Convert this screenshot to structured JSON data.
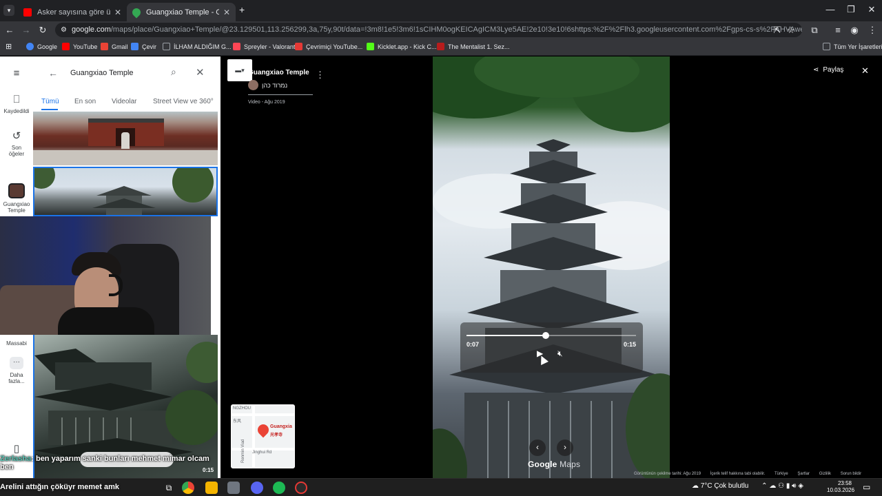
{
  "browser": {
    "tabs": [
      {
        "title": "Asker sayısına göre ülkeler - YouTube",
        "active": false,
        "favicon_color": "#ff0000"
      },
      {
        "title": "Guangxiao Temple - Google Haritalar",
        "active": true,
        "favicon_color": "#34a853"
      }
    ],
    "url_host": "google.com",
    "url_rest": "/maps/place/Guangxiao+Temple/@23.129501,113.256299,3a,75y,90t/data=!3m8!1e5!3m6!1sCIHM0ogKEICAgICM3Lye5AE!2e10!3e10!6shttps:%2F%2Flh3.googleusercontent.com%2Fgps-cs-s%2FAHVAwepova-b2nGUfNemF-DLiL2gT...",
    "bookmarks": [
      {
        "label": "Google",
        "color": "#4285f4"
      },
      {
        "label": "YouTube",
        "color": "#ff0000"
      },
      {
        "label": "Gmail",
        "color": "#ea4335"
      },
      {
        "label": "Çevir",
        "color": "#4285f4"
      },
      {
        "label": "İLHAM ALDIĞIM G...",
        "color": "#9aa0a6"
      },
      {
        "label": "Spreyler - Valorant",
        "color": "#ff4655"
      },
      {
        "label": "Çevrimiçi YouTube...",
        "color": "#e53935"
      },
      {
        "label": "Kicklet.app - Kick C...",
        "color": "#53fc18"
      },
      {
        "label": "The Mentalist 1. Sez...",
        "color": "#b71c1c"
      }
    ],
    "all_bookmarks": "Tüm Yer İşaretleri"
  },
  "maps": {
    "search_value": "Guangxiao Temple",
    "rail": [
      {
        "label": "Kaydedildi",
        "icon": "bookmark-icon"
      },
      {
        "label": "Son öğeler",
        "icon": "history-icon"
      },
      {
        "label": "Guangxiao Temple",
        "icon": "place-thumbnail"
      },
      {
        "label": "Massabi",
        "icon": "place-thumbnail"
      },
      {
        "label": "Daha fazla...",
        "icon": "more-icon"
      }
    ],
    "photo_tabs": [
      "Tümü",
      "En son",
      "Videolar",
      "Street View ve 360°"
    ]
  },
  "viewer": {
    "place_title": "Guangxiao Temple",
    "author": "נמרוד כהן",
    "meta": "Video - Ağu 2019",
    "current_time": "0:07",
    "duration": "0:15",
    "progress": 0.4667,
    "share_label": "Paylaş",
    "logo_google": "Google",
    "logo_maps": "Maps",
    "footer": [
      "Görüntünün çekilme tarihi: Ağu 2019",
      "İçerik telif hakkına tabi olabilir.",
      "Türkiye",
      "Şartlar",
      "Gizlilik",
      "Sorun bildir"
    ],
    "minimap_label": "Guangxia",
    "minimap_label_cn": "光孝寺",
    "minimap_roads": [
      "Renmin Viad",
      "Jinghui Rd",
      "NGZHOU",
      "东风"
    ]
  },
  "stream": {
    "chat_user": "Zerlasha",
    "chat_text": ": ben yaparım sanki bunları mehmet mimar olcam ben",
    "chat_time": "0:15",
    "ticker": "Arelini attığın çöküyr memet amk"
  },
  "taskbar": {
    "weather": "7°C  Çok bulutlu",
    "time": "23:58",
    "date": "10.03.2026"
  }
}
